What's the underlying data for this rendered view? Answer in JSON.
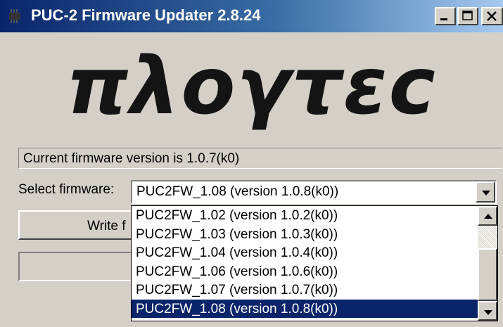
{
  "window": {
    "title": "PUC-2 Firmware Updater 2.8.24",
    "icon": "chip-icon",
    "controls": [
      "minimize",
      "maximize",
      "close"
    ]
  },
  "logo": {
    "text": "πλογτεc"
  },
  "status": {
    "text": "Current firmware version is 1.0.7(k0)"
  },
  "firmware_select": {
    "label": "Select firmware:",
    "selected": "PUC2FW_1.08 (version 1.0.8(k0))",
    "options": [
      "PUC2FW_1.02 (version 1.0.2(k0))",
      "PUC2FW_1.03 (version 1.0.3(k0))",
      "PUC2FW_1.04 (version 1.0.4(k0))",
      "PUC2FW_1.06 (version 1.0.6(k0))",
      "PUC2FW_1.07 (version 1.0.7(k0))",
      "PUC2FW_1.08 (version 1.0.8(k0))"
    ],
    "highlighted_index": 5
  },
  "write_button": {
    "label": "Write f"
  },
  "colors": {
    "title_bar": "#0a246a",
    "selection": "#0a246a",
    "face": "#d4d0c8"
  }
}
